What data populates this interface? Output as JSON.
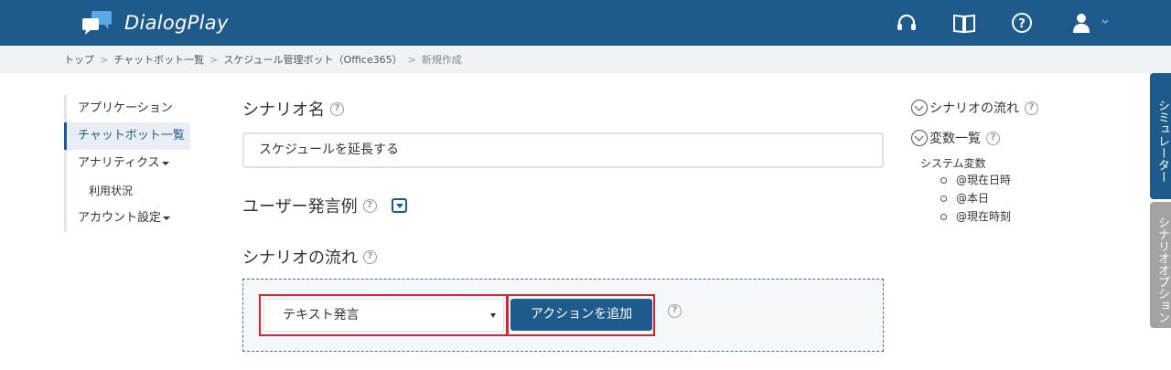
{
  "header": {
    "logo_text": "DialogPlay",
    "icons": [
      "headset-icon",
      "book-icon",
      "help-circle-icon",
      "user-icon",
      "chevron-down-icon"
    ]
  },
  "breadcrumb": {
    "items": [
      "トップ",
      "チャットボット一覧",
      "スケジュール管理ボット（Office365）"
    ],
    "current": "新規作成",
    "separator": ">"
  },
  "sidebar": {
    "items": [
      {
        "label": "アプリケーション"
      },
      {
        "label": "チャットボット一覧"
      },
      {
        "label": "アナリティクス"
      },
      {
        "label": "利用状況"
      },
      {
        "label": "アカウント設定"
      }
    ]
  },
  "main": {
    "scenario_name_label": "シナリオ名",
    "scenario_name_value": "スケジュールを延長する",
    "user_utterance_label": "ユーザー発言例",
    "scenario_flow_label": "シナリオの流れ",
    "action_select_value": "テキスト発言",
    "add_action_label": "アクションを追加",
    "help_glyph": "?"
  },
  "right_panel": {
    "flow_heading": "シナリオの流れ",
    "vars_heading": "変数一覧",
    "system_vars_title": "システム変数",
    "system_vars": [
      "@現在日時",
      "@本日",
      "@現在時刻"
    ]
  },
  "side_tabs": {
    "simulator": "シミュレーター",
    "scenario_option": "シナリオオプション"
  },
  "colors": {
    "brand": "#1e5b8c",
    "highlight": "#e0222f"
  }
}
